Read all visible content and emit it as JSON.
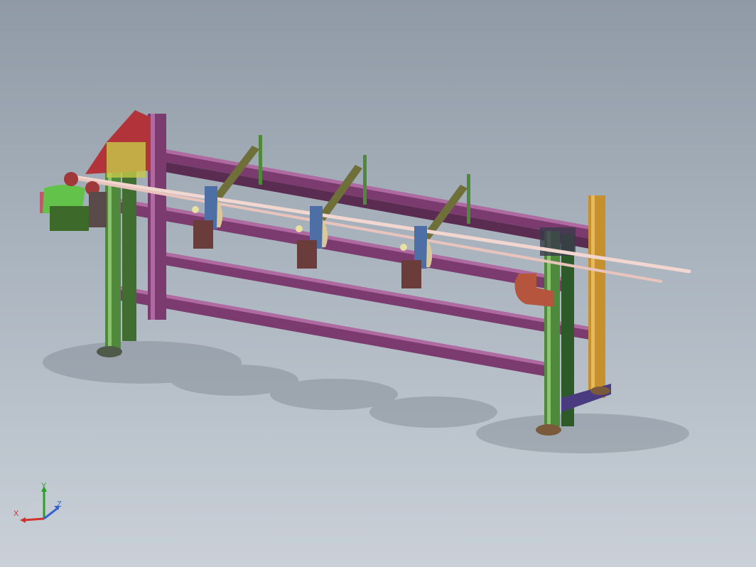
{
  "viewport": {
    "description_free": true,
    "colors": {
      "background_top": "#8f9aa6",
      "background_bottom": "#c9d0d8",
      "rail": "#7b3b6e",
      "rail_dark": "#3a2a3a",
      "post_green": "#4f8a3c",
      "post_orange": "#c7902e",
      "plate_red": "#b3333a",
      "tube": "#f2d6d0",
      "clamp_blue": "#4d6fa6",
      "clamp_brown": "#6b3d3a",
      "motor_green": "#62c24a",
      "hook": "#b6553e"
    }
  },
  "triad": {
    "x_label": "X",
    "y_label": "Y",
    "z_label": "Z",
    "icon": "coordinate-triad-icon",
    "colors": {
      "x": "#d33030",
      "y": "#2aa02a",
      "z": "#2f5fd0"
    }
  }
}
